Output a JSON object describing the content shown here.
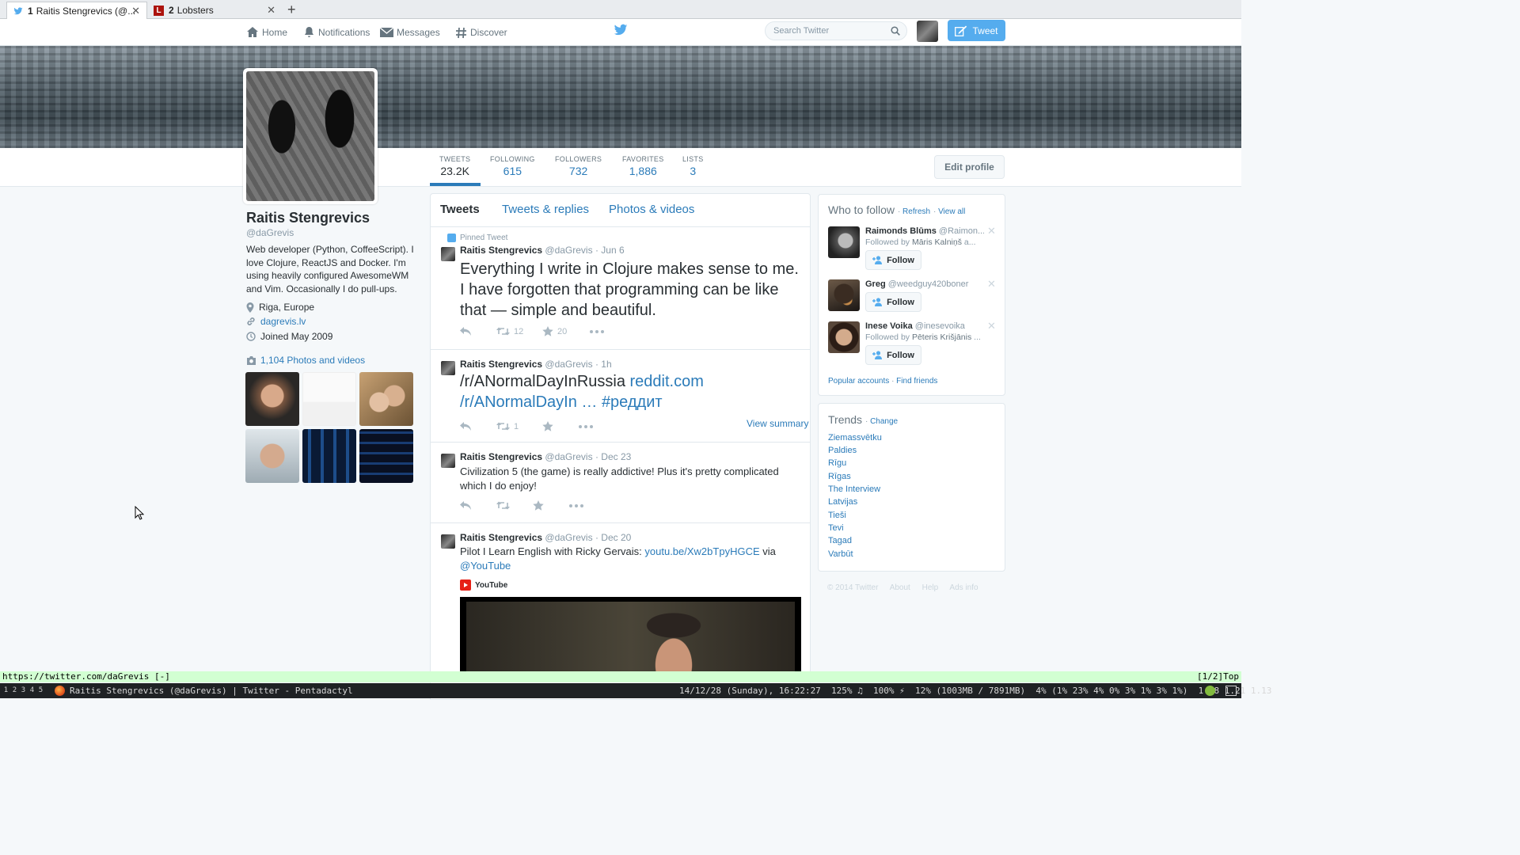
{
  "browser": {
    "tabs": [
      {
        "num": "1",
        "title": "Raitis Stengrevics (@...",
        "favicon": "twitter-icon"
      },
      {
        "num": "2",
        "title": "Lobsters",
        "favicon": "lobsters-icon"
      }
    ],
    "new_tab": "+"
  },
  "nav": {
    "home": "Home",
    "notifications": "Notifications",
    "messages": "Messages",
    "discover": "Discover",
    "search_placeholder": "Search Twitter",
    "tweet_button": "Tweet"
  },
  "profile": {
    "name": "Raitis Stengrevics",
    "handle": "@daGrevis",
    "bio": "Web developer (Python, CoffeeScript). I love Clojure, ReactJS and Docker. I'm using heavily configured AwesomeWM and Vim. Occasionally I do pull-ups.",
    "location": "Riga, Europe",
    "website": "dagrevis.lv",
    "joined": "Joined May 2009",
    "photos_link": "1,104 Photos and videos",
    "edit_profile": "Edit profile"
  },
  "stats": [
    {
      "label": "TWEETS",
      "value": "23.2K"
    },
    {
      "label": "FOLLOWING",
      "value": "615"
    },
    {
      "label": "FOLLOWERS",
      "value": "732"
    },
    {
      "label": "FAVORITES",
      "value": "1,886"
    },
    {
      "label": "LISTS",
      "value": "3"
    }
  ],
  "timeline": {
    "tabs": [
      "Tweets",
      "Tweets & replies",
      "Photos & videos"
    ],
    "pinned_label": "Pinned Tweet",
    "tweets": [
      {
        "name": "Raitis Stengrevics",
        "handle": "@daGrevis",
        "time": "Jun 6",
        "text": "Everything I write in Clojure makes sense to me. I have forgotten that programming can be like that — simple and beautiful.",
        "retweets": "12",
        "favorites": "20"
      },
      {
        "name": "Raitis Stengrevics",
        "handle": "@daGrevis",
        "time": "1h",
        "text_plain": "/r/ANormalDayInRussia",
        "link1": "reddit.com",
        "link2": "/r/ANormalDayIn …",
        "hashtag": "#реддит",
        "retweets": "1",
        "view_summary": "View summary"
      },
      {
        "name": "Raitis Stengrevics",
        "handle": "@daGrevis",
        "time": "Dec 23",
        "text": "Civilization 5 (the game) is really addictive! Plus it's pretty complicated which I do enjoy!"
      },
      {
        "name": "Raitis Stengrevics",
        "handle": "@daGrevis",
        "time": "Dec 20",
        "text_plain": "Pilot I Learn English with Ricky Gervais:",
        "link": "youtu.be/Xw2bTpyHGCE",
        "via": "via",
        "mention": "@YouTube",
        "card_source": "YouTube"
      }
    ]
  },
  "who_to_follow": {
    "title": "Who to follow",
    "refresh": "Refresh",
    "view_all": "View all",
    "follow_label": "Follow",
    "suggestions": [
      {
        "name": "Raimonds Blūms",
        "handle": "@Raimon...",
        "followed_by_prefix": "Followed by",
        "followed_by": "Māris Kalniņš",
        "followed_by_suffix": "a..."
      },
      {
        "name": "Greg",
        "handle": "@weedguy420boner"
      },
      {
        "name": "Inese Voika",
        "handle": "@inesevoika",
        "followed_by_prefix": "Followed by",
        "followed_by": "Pēteris Krišjānis",
        "followed_by_suffix": "..."
      }
    ],
    "popular": "Popular accounts",
    "find_friends": "Find friends"
  },
  "trends": {
    "title": "Trends",
    "change": "Change",
    "items": [
      "Ziemassvētku",
      "Paldies",
      "Rīgu",
      "Rīgas",
      "The Interview",
      "Latvijas",
      "Tieši",
      "Tevi",
      "Tagad",
      "Varbūt"
    ]
  },
  "footer": [
    "© 2014 Twitter",
    "About",
    "Help",
    "Ads info"
  ],
  "statusline": {
    "url": "https://twitter.com/daGrevis [-]",
    "position": "[1/2]Top"
  },
  "wm": {
    "tags": [
      "1",
      "2",
      "3",
      "4",
      "5"
    ],
    "window_title": "Raitis Stengrevics (@daGrevis) | Twitter - Pentadactyl",
    "status": "14/12/28 (Sunday), 16:22:27  125% ♫  100% ⚡  12% (1003MB / 7891MB)  4% (1% 23% 4% 0% 3% 1% 3% 1%)  1.18 1.21 1.13"
  },
  "colors": {
    "twitter_blue": "#55acee",
    "link_blue": "#2b7bb9",
    "statusline_green": "#d2ffd2"
  }
}
